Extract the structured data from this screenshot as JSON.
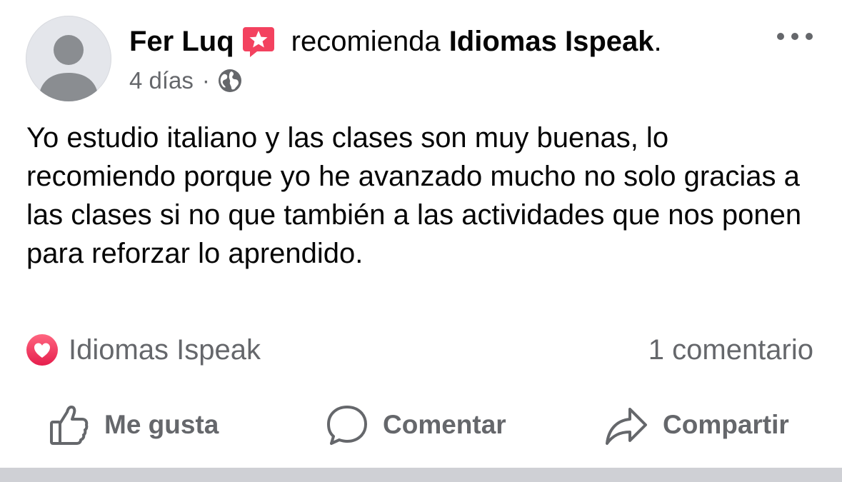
{
  "post": {
    "author": "Fer Luq",
    "badge_icon": "recommendation-star-icon",
    "verb": "recomienda",
    "page_name": "Idiomas Ispeak",
    "period": ".",
    "timestamp": "4 días",
    "separator": "·",
    "audience_icon": "globe-icon",
    "more_icon": "more-options-icon",
    "text": "Yo estudio italiano y las clases son muy buenas, lo recomiendo porque yo he avanzado mucho no solo gracias a las clases si no que también a las actividades que nos ponen para reforzar lo aprendido."
  },
  "reactions": {
    "icon": "heart-reaction-icon",
    "name": "Idiomas Ispeak",
    "comments": "1 comentario"
  },
  "actions": {
    "like": "Me gusta",
    "comment": "Comentar",
    "share": "Compartir"
  },
  "colors": {
    "text": "#050505",
    "secondary": "#65676b",
    "badge": "#f3425f",
    "heart_gradient_top": "#ff6680",
    "heart_gradient_bottom": "#e61e4d",
    "divider": "#cfd0d5"
  }
}
